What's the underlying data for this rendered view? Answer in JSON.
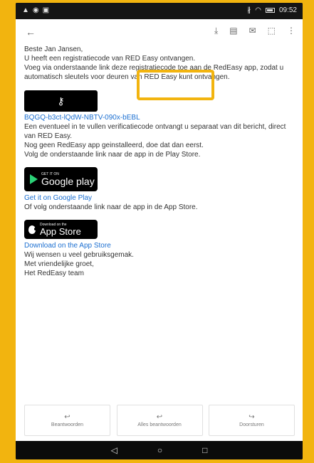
{
  "status": {
    "time": "09:52"
  },
  "email": {
    "greeting": "Beste Jan Jansen,",
    "para1": "U heeft een registratiecode van RED Easy ontvangen.",
    "para2": "Voeg via onderstaande link deze registratiecode toe aan de RedEasy app, zodat u automatisch sleutels voor deuren van RED Easy kunt ontvangen.",
    "code_link": "BQGQ-b3ct-lQdW-NBTV-090x-bEBL",
    "para3": "Een eventueel in te vullen verificatiecode ontvangt u separaat van dit bericht, direct van RED Easy.",
    "para4": "Nog geen RedEasy app geinstalleerd, doe dat dan eerst.",
    "para5": "Volg de onderstaande link naar de app in de Play Store.",
    "google_badge_small": "GET IT ON",
    "google_badge_big": "Google play",
    "google_link": "Get it on Google Play",
    "para6": "Of volg onderstaande link naar de app in de App Store.",
    "apple_badge_small": "Download on the",
    "apple_badge_big": "App Store",
    "appstore_link": "Download on the App Store",
    "para7": "Wij wensen u veel gebruiksgemak.",
    "para8": "Met vriendelijke groet,",
    "para9": "Het RedEasy team"
  },
  "actions": {
    "reply": "Beantwoorden",
    "reply_all": "Alles beantwoorden",
    "forward": "Doorsturen"
  },
  "icons": {
    "back": "arrow-left-icon",
    "download": "download-icon",
    "archive": "archive-icon",
    "mail": "mail-icon",
    "label": "label-icon",
    "more": "more-vert-icon",
    "key": "key-icon",
    "reply": "reply-icon",
    "reply_all": "reply-all-icon",
    "forward": "forward-icon"
  }
}
